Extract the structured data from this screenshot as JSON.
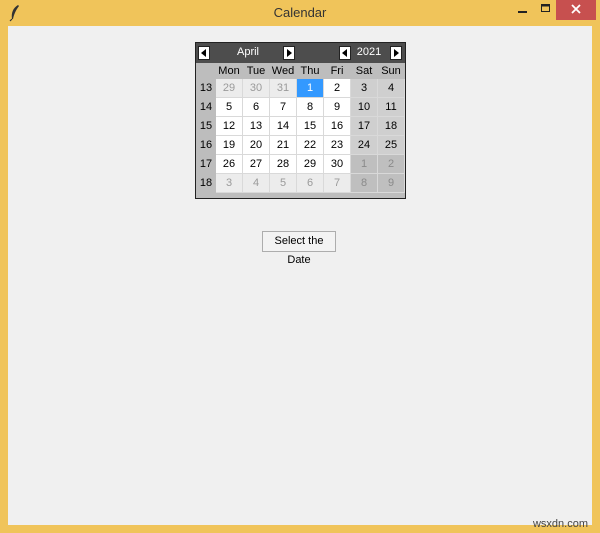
{
  "window": {
    "title": "Calendar",
    "frame_color": "#f0c45a",
    "close_color": "#c7504f"
  },
  "calendar": {
    "month": "April",
    "year": "2021",
    "weekdays": [
      "Mon",
      "Tue",
      "Wed",
      "Thu",
      "Fri",
      "Sat",
      "Sun"
    ],
    "selected_color": "#3399ff",
    "weeks": [
      {
        "num": "13",
        "days": [
          {
            "d": "29",
            "other": true
          },
          {
            "d": "30",
            "other": true
          },
          {
            "d": "31",
            "other": true
          },
          {
            "d": "1",
            "selected": true
          },
          {
            "d": "2"
          },
          {
            "d": "3"
          },
          {
            "d": "4"
          }
        ]
      },
      {
        "num": "14",
        "days": [
          {
            "d": "5"
          },
          {
            "d": "6"
          },
          {
            "d": "7"
          },
          {
            "d": "8"
          },
          {
            "d": "9"
          },
          {
            "d": "10"
          },
          {
            "d": "11"
          }
        ]
      },
      {
        "num": "15",
        "days": [
          {
            "d": "12"
          },
          {
            "d": "13"
          },
          {
            "d": "14"
          },
          {
            "d": "15"
          },
          {
            "d": "16"
          },
          {
            "d": "17"
          },
          {
            "d": "18"
          }
        ]
      },
      {
        "num": "16",
        "days": [
          {
            "d": "19"
          },
          {
            "d": "20"
          },
          {
            "d": "21"
          },
          {
            "d": "22"
          },
          {
            "d": "23"
          },
          {
            "d": "24"
          },
          {
            "d": "25"
          }
        ]
      },
      {
        "num": "17",
        "days": [
          {
            "d": "26"
          },
          {
            "d": "27"
          },
          {
            "d": "28"
          },
          {
            "d": "29"
          },
          {
            "d": "30"
          },
          {
            "d": "1",
            "other": true
          },
          {
            "d": "2",
            "other": true
          }
        ]
      },
      {
        "num": "18",
        "days": [
          {
            "d": "3",
            "other": true
          },
          {
            "d": "4",
            "other": true
          },
          {
            "d": "5",
            "other": true
          },
          {
            "d": "6",
            "other": true
          },
          {
            "d": "7",
            "other": true
          },
          {
            "d": "8",
            "other": true
          },
          {
            "d": "9",
            "other": true
          }
        ]
      }
    ]
  },
  "button": {
    "label": "Select the Date"
  },
  "watermark": "wsxdn.com",
  "icons": {
    "app": "feather-icon",
    "minimize": "minimize-icon",
    "maximize": "maximize-icon",
    "close": "close-icon",
    "prev": "arrow-left-icon",
    "next": "arrow-right-icon"
  }
}
